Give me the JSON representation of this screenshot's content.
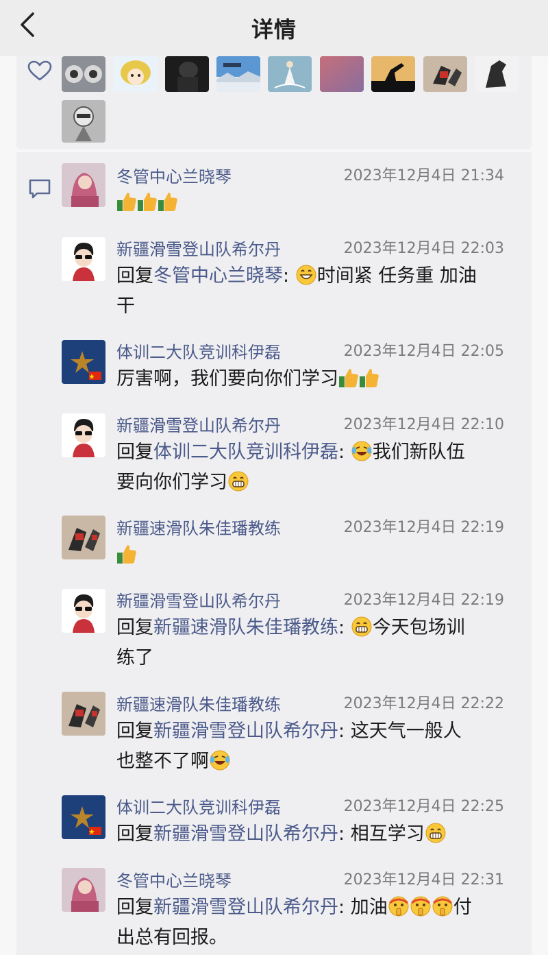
{
  "header": {
    "title": "详情"
  },
  "icons": {
    "back": "chevron-left-icon",
    "like": "heart-icon",
    "comment": "comment-bubble-icon"
  },
  "comments": [
    {
      "name": "冬管中心兰晓琴",
      "time": "2023年12月4日 21:34",
      "avatar": "pink-hair-woman"
    },
    {
      "name": "新疆滑雪登山队希尔丹",
      "time": "2023年12月4日 22:03",
      "avatar": "cartoon-sunglasses",
      "reply_to": "冬管中心兰晓琴",
      "text": "时间紧 任务重 加油",
      "text2": "干"
    },
    {
      "name": "体训二大队竞训科伊磊",
      "time": "2023年12月4日 22:05",
      "avatar": "star-flag",
      "text": "厉害啊，我们要向你们学习"
    },
    {
      "name": "新疆滑雪登山队希尔丹",
      "time": "2023年12月4日 22:10",
      "avatar": "cartoon-sunglasses",
      "reply_to": "体训二大队竞训科伊磊",
      "text": "我们新队伍",
      "text2": "要向你们学习"
    },
    {
      "name": "新疆速滑队朱佳璠教练",
      "time": "2023年12月4日 22:19",
      "avatar": "speed-skaters"
    },
    {
      "name": "新疆滑雪登山队希尔丹",
      "time": "2023年12月4日 22:19",
      "avatar": "cartoon-sunglasses",
      "reply_to": "新疆速滑队朱佳璠教练",
      "text": "今天包场训",
      "text2": "练了"
    },
    {
      "name": "新疆速滑队朱佳璠教练",
      "time": "2023年12月4日 22:22",
      "avatar": "speed-skaters",
      "reply_to": "新疆滑雪登山队希尔丹",
      "text": "这天气一般人",
      "text2": "也整不了啊"
    },
    {
      "name": "体训二大队竞训科伊磊",
      "time": "2023年12月4日 22:25",
      "avatar": "star-flag",
      "reply_to": "新疆滑雪登山队希尔丹",
      "text": "相互学习"
    },
    {
      "name": "冬管中心兰晓琴",
      "time": "2023年12月4日 22:31",
      "avatar": "pink-hair-woman",
      "reply_to": "新疆滑雪登山队希尔丹",
      "text": "加油",
      "text_after": "付",
      "text2": "出总有回报。"
    }
  ],
  "reply_prefix": "回复",
  "colon": ":"
}
